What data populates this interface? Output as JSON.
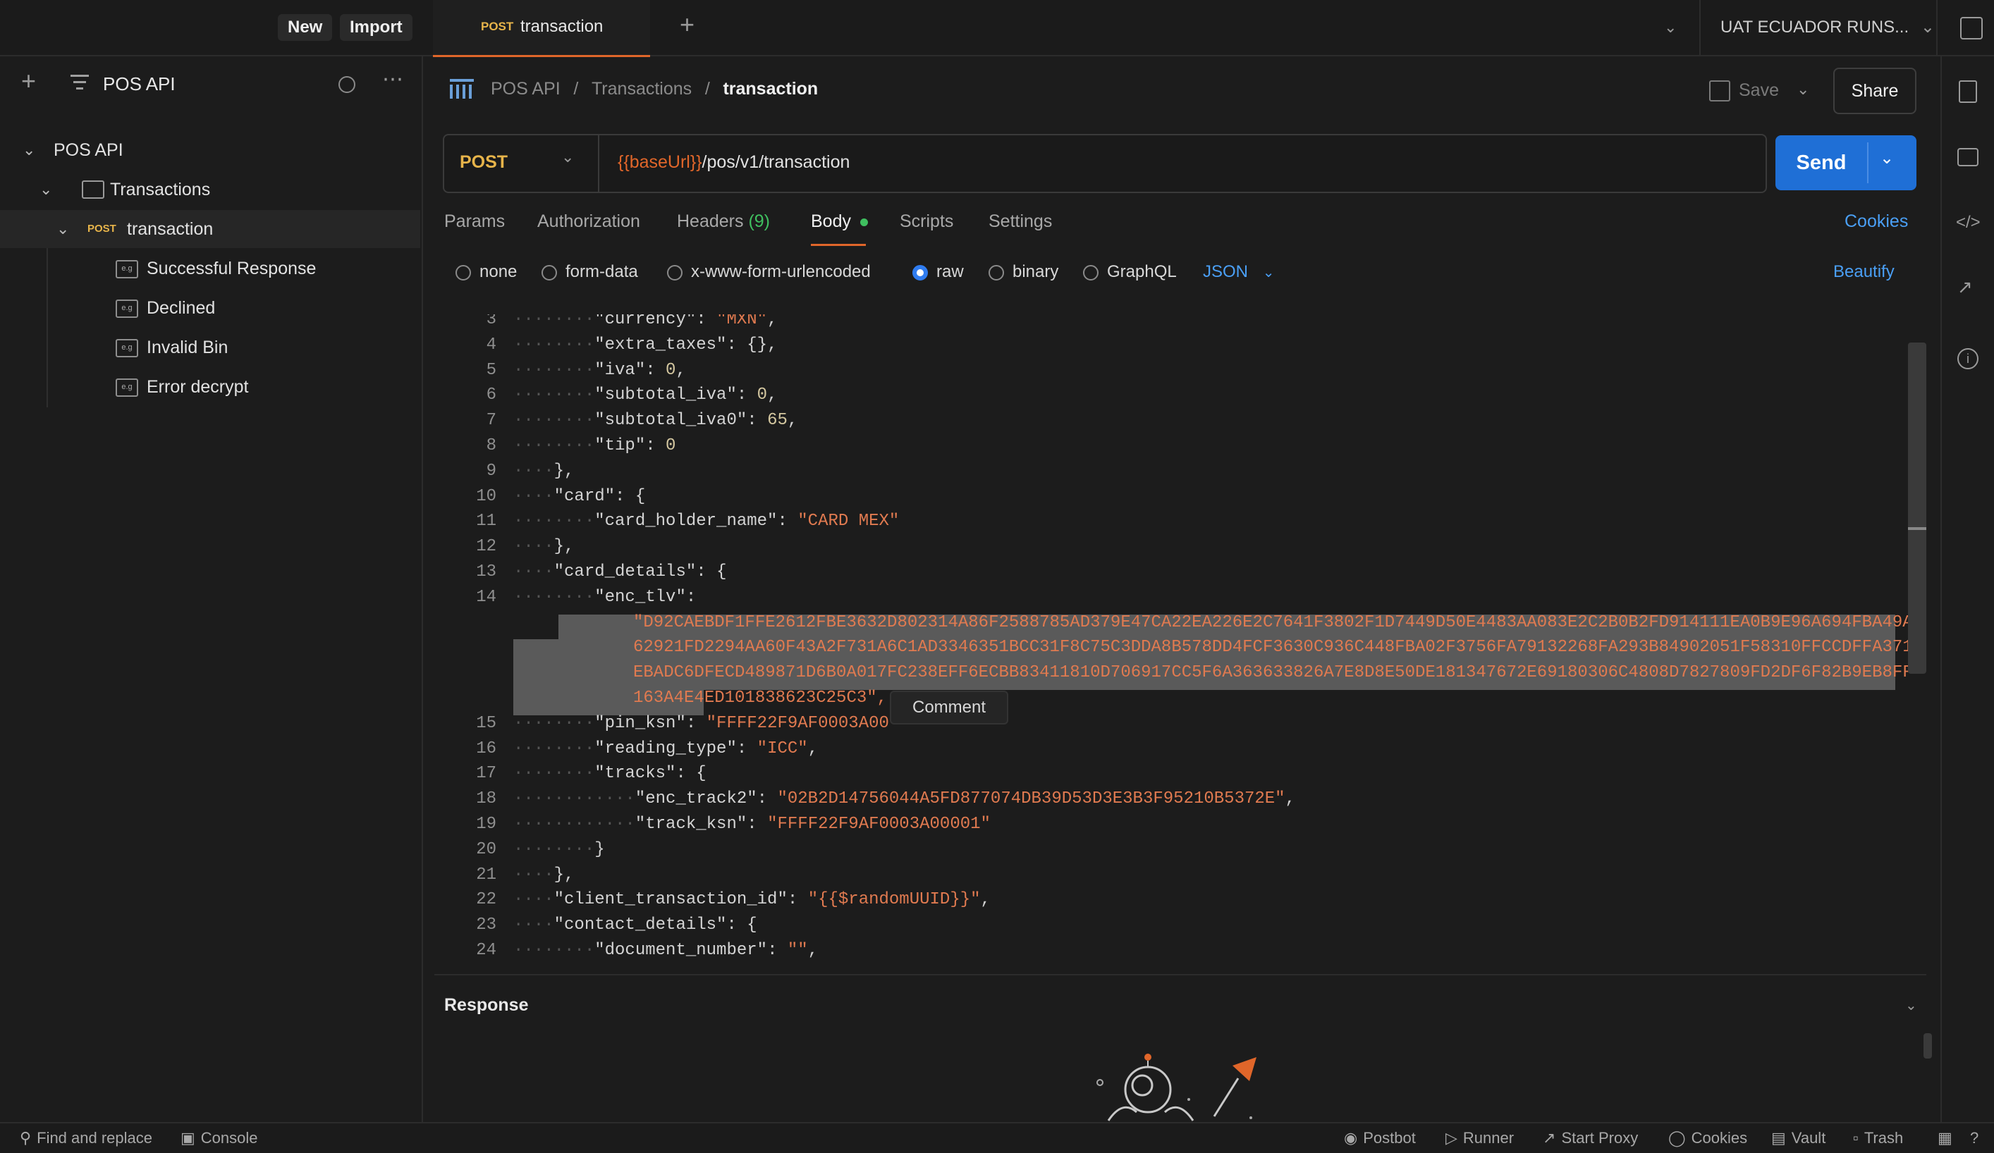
{
  "topbar": {
    "new_label": "New",
    "import_label": "Import",
    "tab_method": "POST",
    "tab_name": "transaction",
    "add_tab": "+",
    "environment": "UAT ECUADOR RUNS..."
  },
  "sidebar": {
    "workspace_title": "POS API",
    "tree": {
      "collection": "POS API",
      "folder": "Transactions",
      "request_method": "POST",
      "request_name": "transaction",
      "examples": [
        "Successful Response",
        "Declined",
        "Invalid Bin",
        "Error decrypt"
      ],
      "example_icon": "e.g"
    }
  },
  "breadcrumb": {
    "collection": "POS API",
    "folder": "Transactions",
    "sep": "/",
    "request": "transaction"
  },
  "actions": {
    "save_label": "Save",
    "share_label": "Share"
  },
  "request": {
    "method": "POST",
    "url_var": "{{baseUrl}}",
    "url_path": "/pos/v1/transaction",
    "send_label": "Send"
  },
  "request_tabs": {
    "params": "Params",
    "authorization": "Authorization",
    "headers": "Headers",
    "headers_count": "(9)",
    "body": "Body",
    "scripts": "Scripts",
    "settings": "Settings",
    "cookies": "Cookies"
  },
  "body_options": {
    "none": "none",
    "form_data": "form-data",
    "urlencoded": "x-www-form-urlencoded",
    "raw": "raw",
    "binary": "binary",
    "graphql": "GraphQL",
    "format": "JSON",
    "beautify": "Beautify",
    "selected": "raw"
  },
  "editor": {
    "tooltip": "Comment",
    "lines": [
      {
        "n": "3",
        "key": "\"currency\"",
        "val": "\"MXN\"",
        "tail": ","
      },
      {
        "n": "4",
        "key": "\"extra_taxes\"",
        "val": "{}",
        "tail": ","
      },
      {
        "n": "5",
        "key": "\"iva\"",
        "val": "0",
        "tail": ","
      },
      {
        "n": "6",
        "key": "\"subtotal_iva\"",
        "val": "0",
        "tail": ","
      },
      {
        "n": "7",
        "key": "\"subtotal_iva0\"",
        "val": "65",
        "tail": ","
      },
      {
        "n": "8",
        "key": "\"tip\"",
        "val": "0",
        "tail": ""
      },
      {
        "n": "9",
        "plain": "},"
      },
      {
        "n": "10",
        "key": "\"card\"",
        "val": "{",
        "tail": ""
      },
      {
        "n": "11",
        "key": "\"card_holder_name\"",
        "val": "\"CARD MEX\"",
        "tail": ""
      },
      {
        "n": "12",
        "plain": "},"
      },
      {
        "n": "13",
        "key": "\"card_details\"",
        "val": "{",
        "tail": ""
      },
      {
        "n": "14",
        "key": "\"enc_tlv\"",
        "val": "",
        "tail": ""
      },
      {
        "n": "15",
        "key": "\"pin_ksn\"",
        "val": "\"FFFF22F9AF0003A00",
        "tail": ""
      },
      {
        "n": "16",
        "key": "\"reading_type\"",
        "val": "\"ICC\"",
        "tail": ","
      },
      {
        "n": "17",
        "key": "\"tracks\"",
        "val": "{",
        "tail": ""
      },
      {
        "n": "18",
        "key": "\"enc_track2\"",
        "val": "\"02B2D14756044A5FD877074DB39D53D3E3B3F95210B5372E\"",
        "tail": ","
      },
      {
        "n": "19",
        "key": "\"track_ksn\"",
        "val": "\"FFFF22F9AF0003A00001\"",
        "tail": ""
      },
      {
        "n": "20",
        "plain": "}"
      },
      {
        "n": "21",
        "plain": "},"
      },
      {
        "n": "22",
        "key": "\"client_transaction_id\"",
        "val": "\"{{$randomUUID}}\"",
        "tail": ","
      },
      {
        "n": "23",
        "key": "\"contact_details\"",
        "val": "{",
        "tail": ""
      },
      {
        "n": "24",
        "key": "\"document_number\"",
        "val": "\"\"",
        "tail": ","
      }
    ],
    "enc_tlv_wrapped": [
      "\"D92CAEBDF1FFE2612FBE3632D802314A86F2588785AD379E47CA22EA226E2C7641F3802F1D7449D50E4483AA083E2C2B0B2FD914111EA0B9E96A694FBA49A",
      "62921FD2294AA60F43A2F731A6C1AD3346351BCC31F8C75C3DDA8B578DD4FCF3630C936C448FBA02F3756FA79132268FA293B84902051F58310FFCCDFFA371",
      "EBADC6DFECD489871D6B0A017FC238EFF6ECBB83411810D706917CC5F6A363633826A7E8D8E50DE181347672E69180306C4808D7827809FD2DF6F82B9EB8FF",
      "163A4E4ED101838623C25C3\","
    ]
  },
  "response": {
    "label": "Response"
  },
  "footer": {
    "find_replace": "Find and replace",
    "console": "Console",
    "postbot": "Postbot",
    "runner": "Runner",
    "start_proxy": "Start Proxy",
    "cookies": "Cookies",
    "vault": "Vault",
    "trash": "Trash"
  },
  "colors": {
    "accent_orange": "#e0662a",
    "send_blue": "#1f6fd6",
    "link_blue": "#4a9ff5",
    "method_yellow": "#e7b44a",
    "string_orange": "#e07a50",
    "green_dot": "#3fbf5f"
  }
}
